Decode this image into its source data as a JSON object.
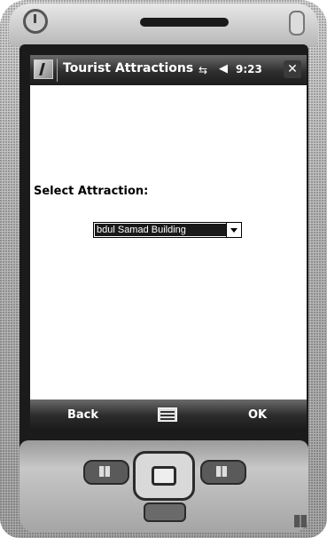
{
  "window": {
    "title": "Tourist Attractions",
    "clock": "9:23",
    "close_label": "✕",
    "signal_icon": "signal-icon",
    "volume_icon": "volume-icon"
  },
  "content": {
    "select_label": "Select Attraction:",
    "dropdown_value": "bdul Samad Building"
  },
  "softkeys": {
    "left_label": "Back",
    "right_label": "OK",
    "center_icon": "keyboard-icon"
  },
  "colors": {
    "titlebar": "#2e2e2e",
    "screen_bg": "#ffffff",
    "dropdown_selected_bg": "#1a1a1a"
  }
}
